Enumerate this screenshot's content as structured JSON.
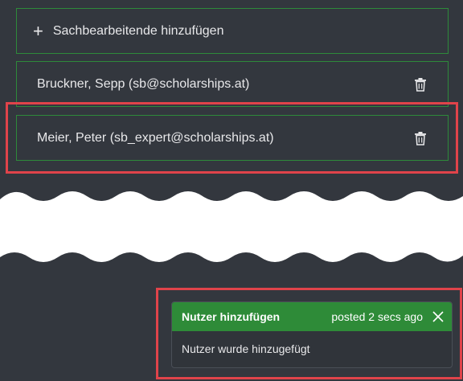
{
  "colors": {
    "background": "#33373e",
    "row_border": "#2e8a3a",
    "highlight": "#e0434a",
    "toast_header": "#2e8b38"
  },
  "add_row": {
    "icon": "plus-icon",
    "label": "Sachbearbeitende hinzufügen"
  },
  "members": [
    {
      "label": "Bruckner, Sepp (sb@scholarships.at)",
      "action_icon": "trash-icon"
    },
    {
      "label": "Meier, Peter (sb_expert@scholarships.at)",
      "action_icon": "trash-icon"
    }
  ],
  "toast": {
    "title": "Nutzer hinzufügen",
    "time": "posted 2 secs ago",
    "close_icon": "close-icon",
    "message": "Nutzer wurde hinzugefügt"
  }
}
